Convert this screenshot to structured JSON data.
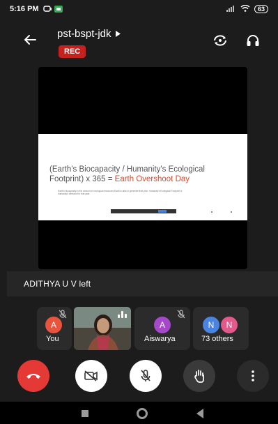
{
  "status_bar": {
    "time": "5:16 PM",
    "battery": "63"
  },
  "header": {
    "meeting_code": "pst-bspt-jdk",
    "rec_badge": "REC"
  },
  "presentation": {
    "title_main": "(Earth's Biocapacity / Humanity's Ecological Footprint) x 365 = ",
    "title_accent": "Earth Overshoot Day",
    "accent_color": "#d64a2c",
    "body": "Earth's biocapacity is the amount of ecological resources Earth is able to generate that year. Humanity's Ecological Footprint is humanity's demand for that year."
  },
  "notification": {
    "text": "ADITHYA U V left"
  },
  "participants": [
    {
      "initial": "A",
      "label": "You",
      "avatar_color": "#e8553e",
      "muted": true
    },
    {
      "label": "",
      "video": true
    },
    {
      "initial": "A",
      "label": "Aiswarya",
      "avatar_color": "#a548c9",
      "muted": true
    },
    {
      "initials": [
        "N",
        "N"
      ],
      "label": "73 others",
      "avatar_colors": [
        "#4a84e0",
        "#e25a8c"
      ]
    }
  ],
  "controls": {
    "end_call_color": "#e53935",
    "icons": [
      "end-call-icon",
      "camera-off-icon",
      "mic-off-icon",
      "raise-hand-icon",
      "more-options-icon"
    ]
  }
}
